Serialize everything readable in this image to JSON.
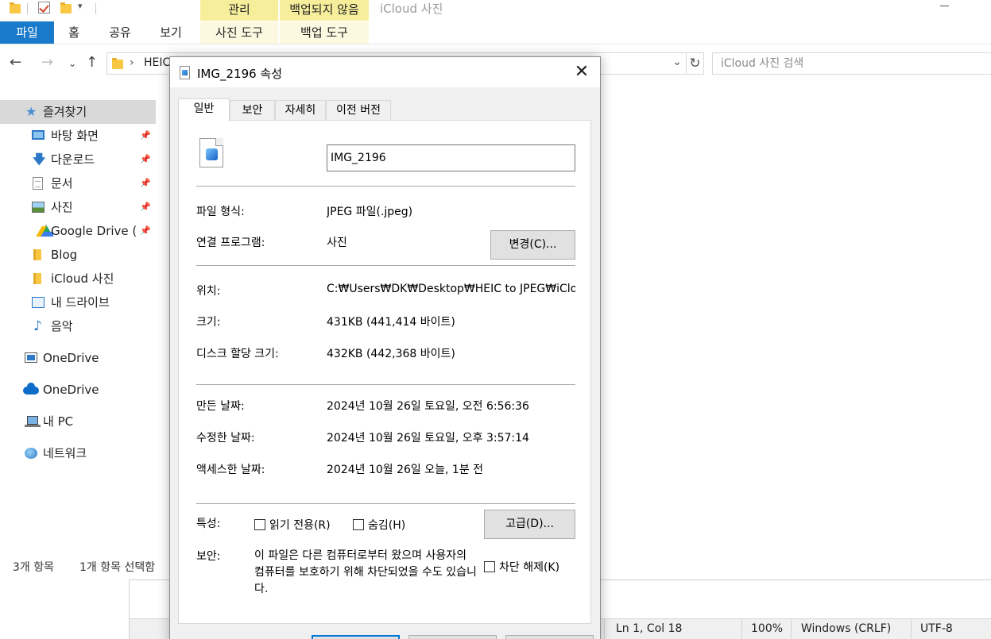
{
  "explorer": {
    "window_title": "iCloud 사진",
    "ribbon": {
      "file_tab": "파일",
      "tabs": [
        "홈",
        "공유",
        "보기"
      ],
      "context_groups": [
        {
          "header": "관리",
          "tab": "사진 도구"
        },
        {
          "header": "백업되지 않음",
          "tab": "백업 도구"
        }
      ]
    },
    "address": {
      "segment": "HEIC",
      "separator": "›"
    },
    "search_placeholder": "iCloud 사진 검색",
    "sidebar": {
      "quick_access": "즐겨찾기",
      "items": [
        {
          "label": "바탕 화면",
          "icon": "desktop-icon",
          "pinned": true
        },
        {
          "label": "다운로드",
          "icon": "download-icon",
          "pinned": true
        },
        {
          "label": "문서",
          "icon": "document-icon",
          "pinned": true
        },
        {
          "label": "사진",
          "icon": "pictures-icon",
          "pinned": true
        },
        {
          "label": "Google Drive (G",
          "icon": "google-drive-icon",
          "pinned": true
        },
        {
          "label": "Blog",
          "icon": "folder-icon",
          "pinned": false
        },
        {
          "label": "iCloud 사진",
          "icon": "folder-icon",
          "pinned": false
        },
        {
          "label": "내 드라이브",
          "icon": "my-drive-icon",
          "pinned": false
        },
        {
          "label": "음악",
          "icon": "music-icon",
          "pinned": false
        }
      ],
      "onedrive_1": "OneDrive",
      "onedrive_2": "OneDrive",
      "this_pc": "내 PC",
      "network": "네트워크"
    },
    "status": {
      "item_count": "3개 항목",
      "selection": "1개 항목 선택함"
    }
  },
  "notepad_status": {
    "position": "Ln 1, Col 18",
    "zoom": "100%",
    "line_ending": "Windows (CRLF)",
    "encoding": "UTF-8"
  },
  "dialog": {
    "title": "IMG_2196 속성",
    "tabs": [
      "일반",
      "보안",
      "자세히",
      "이전 버전"
    ],
    "file_name": "IMG_2196",
    "file_type_label": "파일 형식:",
    "file_type_value": "JPEG 파일(.jpeg)",
    "opens_with_label": "연결 프로그램:",
    "opens_with_value": "사진",
    "change_button": "변경(C)...",
    "location_label": "위치:",
    "location_value": "C:₩Users₩DK₩Desktop₩HEIC to JPEG₩iCloud",
    "size_label": "크기:",
    "size_value": "431KB (441,414 바이트)",
    "size_on_disk_label": "디스크 할당 크기:",
    "size_on_disk_value": "432KB (442,368 바이트)",
    "created_label": "만든 날짜:",
    "created_value": "2024년 10월 26일 토요일, 오전 6:56:36",
    "modified_label": "수정한 날짜:",
    "modified_value": "2024년 10월 26일 토요일, 오후 3:57:14",
    "accessed_label": "액세스한 날짜:",
    "accessed_value": "2024년 10월 26일 오늘, 1분 전",
    "attributes_label": "특성:",
    "readonly_label": "읽기 전용(R)",
    "hidden_label": "숨김(H)",
    "advanced_button": "고급(D)...",
    "security_label": "보안:",
    "security_text": "이 파일은 다른 컴퓨터로부터 왔으며 사용자의 컴퓨터를 보호하기 위해 차단되었을 수도 있습니다.",
    "unblock_label": "차단 해제(K)"
  }
}
